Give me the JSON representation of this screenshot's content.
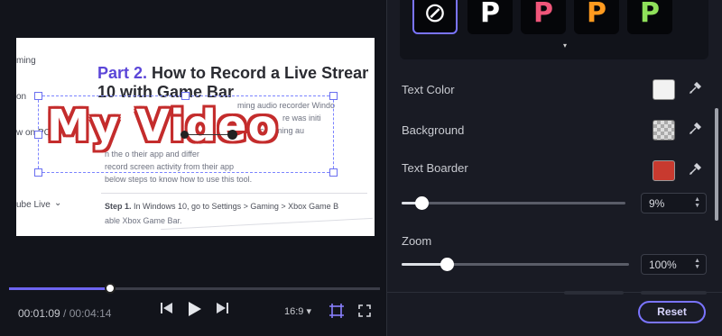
{
  "preview": {
    "nav_items": [
      "ming",
      "on",
      "w on PC",
      "ube Live"
    ],
    "nav_chevron": "chevron-down-icon",
    "doc_title_accent": "Part 2.",
    "doc_title_rest": " How to Record a Live Stream",
    "doc_title_line2": "10 with Game Bar",
    "paragraph_lines": [
      "ming audio recorder Windo",
      "re was initi",
      "the c   eaming au",
      "n the o  their app   and differ",
      "record screen activity from their app",
      "below steps to know how to use this tool."
    ],
    "step_label": "Step 1.",
    "step_text": " In Windows 10, go to Settings > Gaming > Xbox Game B",
    "step_line2": "able Xbox Game Bar.",
    "overlay_text": "My Video"
  },
  "player": {
    "current_time": "00:01:09",
    "separator": " / ",
    "duration": "00:04:14",
    "progress_fraction": 0.272,
    "aspect_ratio": "16:9 ▾",
    "icons": {
      "prev": "skip-back-icon",
      "play": "play-icon",
      "next": "skip-forward-icon",
      "crop": "crop-frame-icon",
      "fullscreen": "fullscreen-icon"
    }
  },
  "panel": {
    "styles": [
      {
        "glyph": "⊘",
        "color": "#ffffff",
        "selected": true,
        "name": "none"
      },
      {
        "glyph": "P",
        "color": "#ffffff",
        "selected": false,
        "name": "white"
      },
      {
        "glyph": "P",
        "color": "#f0567a",
        "selected": false,
        "name": "pink"
      },
      {
        "glyph": "P",
        "color": "#ff9a1f",
        "selected": false,
        "name": "orange"
      },
      {
        "glyph": "P",
        "color": "#8fe05a",
        "selected": false,
        "name": "green"
      }
    ],
    "more_icon": "▾",
    "text_color_label": "Text Color",
    "text_color": "#f2f2f2",
    "background_label": "Background",
    "background_value": "transparent",
    "text_border_label": "Text Boarder",
    "text_border_color": "#c83a2f",
    "border_size_value": "9%",
    "border_size_fraction": 0.09,
    "zoom_label": "Zoom",
    "zoom_value": "100%",
    "zoom_fraction": 0.2,
    "reset_label": "Reset",
    "eyedropper_icon": "eyedropper-icon"
  }
}
